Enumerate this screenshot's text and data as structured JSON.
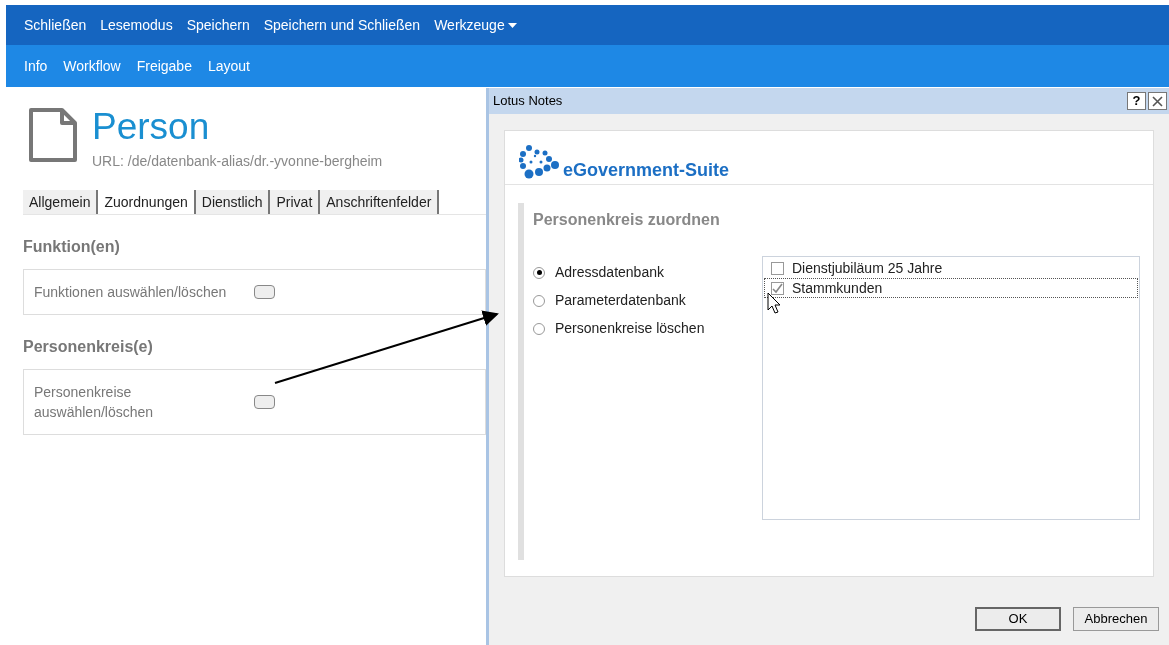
{
  "menu": [
    {
      "label": "Schließen",
      "kind": "link"
    },
    {
      "label": "Lesemodus",
      "kind": "link"
    },
    {
      "label": "Speichern",
      "kind": "link"
    },
    {
      "label": "Speichern und Schließen",
      "kind": "link"
    },
    {
      "label": "Werkzeuge",
      "kind": "dropdown"
    }
  ],
  "nav": [
    "Info",
    "Workflow",
    "Freigabe",
    "Layout"
  ],
  "page": {
    "title": "Person",
    "url": "URL: /de/datenbank-alias/dr.-yvonne-bergheim",
    "tabs": [
      {
        "label": "Allgemein",
        "selected": false
      },
      {
        "label": "Zuordnungen",
        "selected": true
      },
      {
        "label": "Dienstlich",
        "selected": false
      },
      {
        "label": "Privat",
        "selected": false
      },
      {
        "label": "Anschriftenfelder",
        "selected": false
      }
    ],
    "sections": [
      {
        "heading": "Funktion(en)",
        "label": "Funktionen auswählen/löschen"
      },
      {
        "heading": "Personenkreis(e)",
        "label": "Personenkreise auswählen/löschen"
      }
    ]
  },
  "dialog": {
    "title": "Lotus Notes",
    "help": "?",
    "brand": "eGovernment-Suite",
    "heading": "Personenkreis zuordnen",
    "sources": [
      {
        "label": "Adressdatenbank",
        "selected": true
      },
      {
        "label": "Parameterdatenbank",
        "selected": false
      },
      {
        "label": "Personenkreise löschen",
        "selected": false
      }
    ],
    "items": [
      {
        "label": "Dienstjubiläum 25 Jahre",
        "checked": false
      },
      {
        "label": "Stammkunden",
        "checked": true
      }
    ],
    "buttons": [
      "OK",
      "Abbrechen"
    ]
  }
}
